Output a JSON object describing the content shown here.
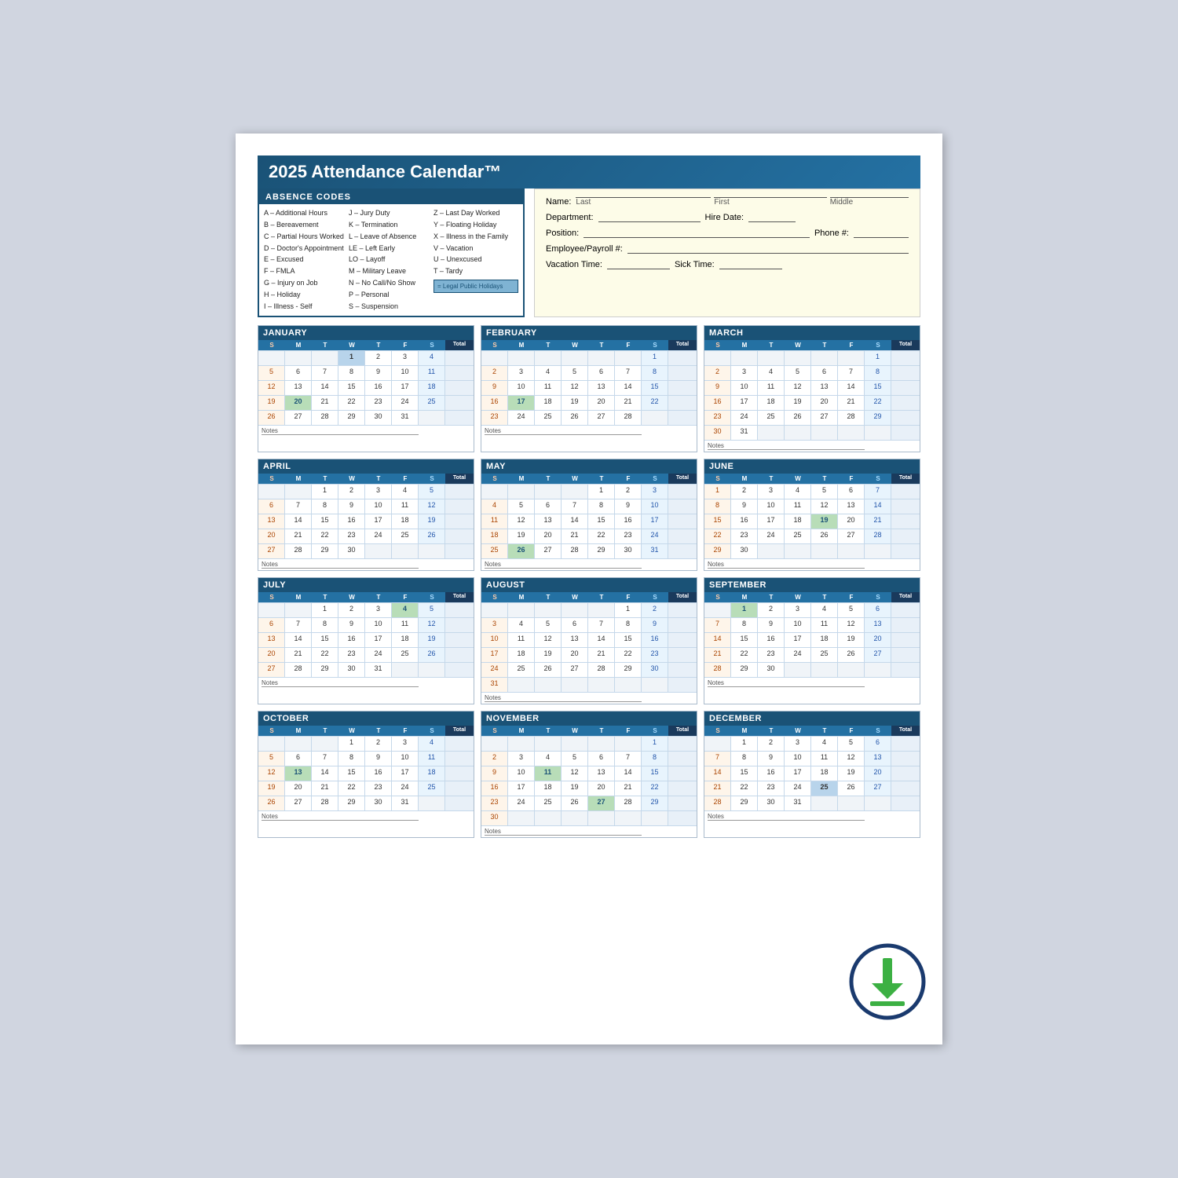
{
  "title": "2025 Attendance Calendar™",
  "absence_codes": {
    "title": "ABSENCE CODES",
    "col1": [
      "A – Additional Hours",
      "B – Bereavement",
      "C – Partial Hours Worked",
      "D – Doctor's Appointment",
      "E – Excused",
      "F – FMLA",
      "G – Injury on Job",
      "H – Holiday",
      "I – Illness - Self"
    ],
    "col2": [
      "J – Jury Duty",
      "K – Termination",
      "L – Leave of Absence",
      "LE – Left Early",
      "LO – Layoff",
      "M – Military Leave",
      "N – No Call/No Show",
      "P – Personal",
      "S – Suspension"
    ],
    "col3": [
      "T – Tardy",
      "U – Unexcused",
      "V – Vacation",
      "X – Illness in the Family",
      "Y – Floating Holiday",
      "Z – Last Day Worked",
      "— –",
      "— –",
      "= Legal Public Holidays"
    ]
  },
  "employee_form": {
    "name_label": "Name:",
    "last_label": "Last",
    "first_label": "First",
    "middle_label": "Middle",
    "dept_label": "Department:",
    "hire_label": "Hire Date:",
    "position_label": "Position:",
    "phone_label": "Phone #:",
    "emp_label": "Employee/Payroll #:",
    "vac_label": "Vacation Time:",
    "sick_label": "Sick Time:"
  },
  "months": [
    {
      "name": "JANUARY",
      "days_header": [
        "S",
        "M",
        "T",
        "W",
        "T",
        "F",
        "S",
        "Total"
      ],
      "weeks": [
        [
          "",
          "",
          "",
          "1",
          "2",
          "3",
          "4",
          ""
        ],
        [
          "5",
          "6",
          "7",
          "8",
          "9",
          "10",
          "11",
          ""
        ],
        [
          "12",
          "13",
          "14",
          "15",
          "16",
          "17",
          "18",
          ""
        ],
        [
          "19",
          "20",
          "21",
          "22",
          "23",
          "24",
          "25",
          ""
        ],
        [
          "26",
          "27",
          "28",
          "29",
          "30",
          "31",
          "",
          ""
        ]
      ],
      "holiday_cells": [
        "1"
      ],
      "highlight_cells": [
        "20"
      ]
    },
    {
      "name": "FEBRUARY",
      "weeks": [
        [
          "",
          "",
          "",
          "",
          "",
          "",
          "1",
          ""
        ],
        [
          "2",
          "3",
          "4",
          "5",
          "6",
          "7",
          "8",
          ""
        ],
        [
          "9",
          "10",
          "11",
          "12",
          "13",
          "14",
          "15",
          ""
        ],
        [
          "16",
          "17",
          "18",
          "19",
          "20",
          "21",
          "22",
          ""
        ],
        [
          "23",
          "24",
          "25",
          "26",
          "27",
          "28",
          "",
          ""
        ]
      ],
      "holiday_cells": [],
      "highlight_cells": [
        "17"
      ]
    },
    {
      "name": "MARCH",
      "weeks": [
        [
          "",
          "",
          "",
          "",
          "",
          "",
          "1",
          ""
        ],
        [
          "2",
          "3",
          "4",
          "5",
          "6",
          "7",
          "8",
          ""
        ],
        [
          "9",
          "10",
          "11",
          "12",
          "13",
          "14",
          "15",
          ""
        ],
        [
          "16",
          "17",
          "18",
          "19",
          "20",
          "21",
          "22",
          ""
        ],
        [
          "23",
          "24",
          "25",
          "26",
          "27",
          "28",
          "29",
          ""
        ],
        [
          "30",
          "31",
          "",
          "",
          "",
          "",
          "",
          ""
        ]
      ],
      "holiday_cells": [],
      "highlight_cells": []
    },
    {
      "name": "APRIL",
      "weeks": [
        [
          "",
          "",
          "1",
          "2",
          "3",
          "4",
          "5",
          ""
        ],
        [
          "6",
          "7",
          "8",
          "9",
          "10",
          "11",
          "12",
          ""
        ],
        [
          "13",
          "14",
          "15",
          "16",
          "17",
          "18",
          "19",
          ""
        ],
        [
          "20",
          "21",
          "22",
          "23",
          "24",
          "25",
          "26",
          ""
        ],
        [
          "27",
          "28",
          "29",
          "30",
          "",
          "",
          "",
          ""
        ]
      ],
      "holiday_cells": [],
      "highlight_cells": []
    },
    {
      "name": "MAY",
      "weeks": [
        [
          "",
          "",
          "",
          "",
          "1",
          "2",
          "3",
          ""
        ],
        [
          "4",
          "5",
          "6",
          "7",
          "8",
          "9",
          "10",
          ""
        ],
        [
          "11",
          "12",
          "13",
          "14",
          "15",
          "16",
          "17",
          ""
        ],
        [
          "18",
          "19",
          "20",
          "21",
          "22",
          "23",
          "24",
          ""
        ],
        [
          "25",
          "26",
          "27",
          "28",
          "29",
          "30",
          "31",
          ""
        ]
      ],
      "holiday_cells": [
        "26"
      ],
      "highlight_cells": [
        "26"
      ]
    },
    {
      "name": "JUNE",
      "weeks": [
        [
          "1",
          "2",
          "3",
          "4",
          "5",
          "6",
          "7",
          ""
        ],
        [
          "8",
          "9",
          "10",
          "11",
          "12",
          "13",
          "14",
          ""
        ],
        [
          "15",
          "16",
          "17",
          "18",
          "19",
          "20",
          "21",
          ""
        ],
        [
          "22",
          "23",
          "24",
          "25",
          "26",
          "27",
          "28",
          ""
        ],
        [
          "29",
          "30",
          "",
          "",
          "",
          "",
          "",
          ""
        ]
      ],
      "holiday_cells": [],
      "highlight_cells": [
        "19"
      ]
    },
    {
      "name": "JULY",
      "weeks": [
        [
          "",
          "",
          "1",
          "2",
          "3",
          "4",
          "5",
          ""
        ],
        [
          "6",
          "7",
          "8",
          "9",
          "10",
          "11",
          "12",
          ""
        ],
        [
          "13",
          "14",
          "15",
          "16",
          "17",
          "18",
          "19",
          ""
        ],
        [
          "20",
          "21",
          "22",
          "23",
          "24",
          "25",
          "26",
          ""
        ],
        [
          "27",
          "28",
          "29",
          "30",
          "31",
          "",
          "",
          ""
        ]
      ],
      "holiday_cells": [
        "4"
      ],
      "highlight_cells": [
        "4"
      ]
    },
    {
      "name": "AUGUST",
      "weeks": [
        [
          "",
          "",
          "",
          "",
          "",
          "1",
          "2",
          ""
        ],
        [
          "3",
          "4",
          "5",
          "6",
          "7",
          "8",
          "9",
          ""
        ],
        [
          "10",
          "11",
          "12",
          "13",
          "14",
          "15",
          "16",
          ""
        ],
        [
          "17",
          "18",
          "19",
          "20",
          "21",
          "22",
          "23",
          ""
        ],
        [
          "24",
          "25",
          "26",
          "27",
          "28",
          "29",
          "30",
          ""
        ],
        [
          "31",
          "",
          "",
          "",
          "",
          "",
          "",
          ""
        ]
      ],
      "holiday_cells": [],
      "highlight_cells": []
    },
    {
      "name": "SEPTEMBER",
      "weeks": [
        [
          "",
          "1",
          "2",
          "3",
          "4",
          "5",
          "6",
          ""
        ],
        [
          "7",
          "8",
          "9",
          "10",
          "11",
          "12",
          "13",
          ""
        ],
        [
          "14",
          "15",
          "16",
          "17",
          "18",
          "19",
          "20",
          ""
        ],
        [
          "21",
          "22",
          "23",
          "24",
          "25",
          "26",
          "27",
          ""
        ],
        [
          "28",
          "29",
          "30",
          "",
          "",
          "",
          "",
          ""
        ]
      ],
      "holiday_cells": [
        "1"
      ],
      "highlight_cells": [
        "1"
      ]
    },
    {
      "name": "OCTOBER",
      "weeks": [
        [
          "",
          "",
          "",
          "1",
          "2",
          "3",
          "4",
          ""
        ],
        [
          "5",
          "6",
          "7",
          "8",
          "9",
          "10",
          "11",
          ""
        ],
        [
          "12",
          "13",
          "14",
          "15",
          "16",
          "17",
          "18",
          ""
        ],
        [
          "19",
          "20",
          "21",
          "22",
          "23",
          "24",
          "25",
          ""
        ],
        [
          "26",
          "27",
          "28",
          "29",
          "30",
          "31",
          "",
          ""
        ]
      ],
      "holiday_cells": [],
      "highlight_cells": [
        "13"
      ]
    },
    {
      "name": "NOVEMBER",
      "weeks": [
        [
          "",
          "",
          "",
          "",
          "",
          "",
          "1",
          ""
        ],
        [
          "2",
          "3",
          "4",
          "5",
          "6",
          "7",
          "8",
          ""
        ],
        [
          "9",
          "10",
          "11",
          "12",
          "13",
          "14",
          "15",
          ""
        ],
        [
          "16",
          "17",
          "18",
          "19",
          "20",
          "21",
          "22",
          ""
        ],
        [
          "23",
          "24",
          "25",
          "26",
          "27",
          "28",
          "29",
          ""
        ],
        [
          "30",
          "",
          "",
          "",
          "",
          "",
          "",
          ""
        ]
      ],
      "holiday_cells": [
        "27"
      ],
      "highlight_cells": [
        "11",
        "27"
      ]
    },
    {
      "name": "DECEMBER",
      "weeks": [
        [
          "",
          "1",
          "2",
          "3",
          "4",
          "5",
          "6",
          ""
        ],
        [
          "7",
          "8",
          "9",
          "10",
          "11",
          "12",
          "13",
          ""
        ],
        [
          "14",
          "15",
          "16",
          "17",
          "18",
          "19",
          "20",
          ""
        ],
        [
          "21",
          "22",
          "23",
          "24",
          "25",
          "26",
          "27",
          ""
        ],
        [
          "28",
          "29",
          "30",
          "31",
          "",
          "",
          "",
          ""
        ]
      ],
      "holiday_cells": [
        "25"
      ],
      "highlight_cells": []
    }
  ],
  "notes_label": "Notes",
  "download_icon": "⬇"
}
